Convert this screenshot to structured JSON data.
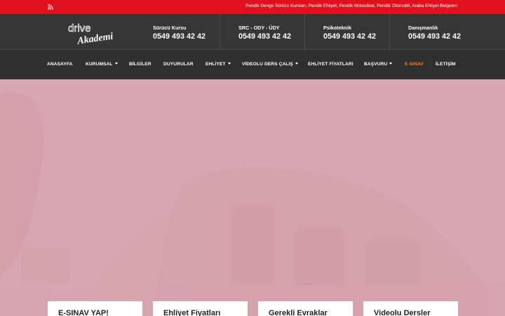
{
  "topbar": {
    "rss_icon": "rss-icon",
    "text": "Pendik Denge Sürücü Kursları, Pendik Ehliyet, Pendik Motosiklet, Pendik Otomobil, Araba Ehliyet Belgeleri"
  },
  "header": {
    "logo": {
      "line1": "drive",
      "line2": "Akademi"
    },
    "contacts": [
      {
        "title": "Sürücü Kursu",
        "phone": "0549 493 42 42"
      },
      {
        "title": "SRC - ODY - ÜDY",
        "phone": "0549 493 42 42"
      },
      {
        "title": "Psikoteknik",
        "phone": "0549 493 42 42"
      },
      {
        "title": "Danışmanlık",
        "phone": "0549 493 42 42"
      }
    ]
  },
  "nav": {
    "items": [
      {
        "label": "ANASAYFA",
        "dropdown": false
      },
      {
        "label": "KURUMSAL",
        "dropdown": true
      },
      {
        "label": "BİLGİLER",
        "dropdown": false
      },
      {
        "label": "DUYURULAR",
        "dropdown": false
      },
      {
        "label": "EHLİYET",
        "dropdown": true
      },
      {
        "label": "VİDEOLU DERS ÇALIŞ",
        "dropdown": true
      },
      {
        "label": "EHLİYET FİYATLARI",
        "dropdown": false
      },
      {
        "label": "BAŞVURU",
        "dropdown": true
      },
      {
        "label": "E-SINAV",
        "dropdown": false,
        "active": true
      },
      {
        "label": "İLETİŞİM",
        "dropdown": false
      }
    ]
  },
  "cards": [
    {
      "title": "E-SINAV YAP!"
    },
    {
      "title": "Ehliyet Fiyatları"
    },
    {
      "title": "Gerekli Evraklar"
    },
    {
      "title": "Videolu Dersler"
    }
  ],
  "colors": {
    "topbar": "#e0101f",
    "header": "#363636",
    "nav": "#2f2f2f",
    "active_nav": "#f4821f",
    "hero_tint": "#d8a6b2"
  }
}
